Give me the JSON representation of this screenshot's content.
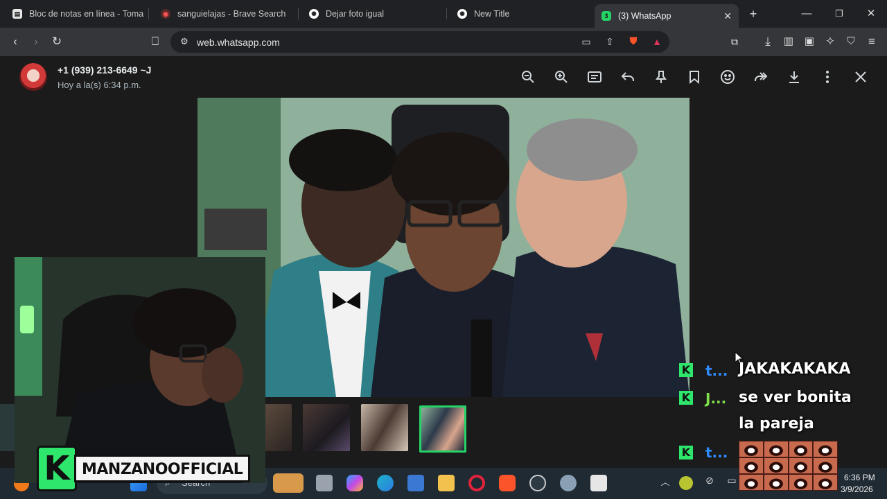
{
  "browser": {
    "tabs": [
      {
        "title": "Bloc de notas en línea - Toma y",
        "active": false
      },
      {
        "title": "sanguielajas - Brave Search",
        "active": false
      },
      {
        "title": "Dejar foto igual",
        "active": false
      },
      {
        "title": "New Title",
        "active": false
      },
      {
        "title": "(3) WhatsApp",
        "active": true,
        "badge": "3"
      }
    ],
    "url": "web.whatsapp.com"
  },
  "viewer": {
    "sender_name": "+1 (939) 213-6649 ~J",
    "timestamp": "Hoy a la(s) 6:34 p.m.",
    "toolbar_icons": [
      "zoom-out-icon",
      "zoom-in-icon",
      "caption-icon",
      "reply-icon",
      "pin-icon",
      "bookmark-icon",
      "emoji-icon",
      "forward-icon",
      "download-icon",
      "menu-icon",
      "close-icon"
    ],
    "thumbnail_count": 5,
    "selected_thumbnail": 5
  },
  "stream": {
    "channel_name": "MANZANOOFFICIAL",
    "brand_letter": "K",
    "chat": [
      {
        "user": "t...",
        "user_color": "#2f8cff",
        "message": "JAKAKAKAKA"
      },
      {
        "user": "J...",
        "user_color": "#7ee04a",
        "message": "se ver bonita"
      },
      {
        "user": "",
        "user_color": "",
        "message": "la pareja"
      },
      {
        "user": "t...",
        "user_color": "#2f8cff",
        "message": ""
      }
    ]
  },
  "taskbar": {
    "search_placeholder": "Search",
    "time": "6:36 PM",
    "date": "3/9/2026"
  }
}
